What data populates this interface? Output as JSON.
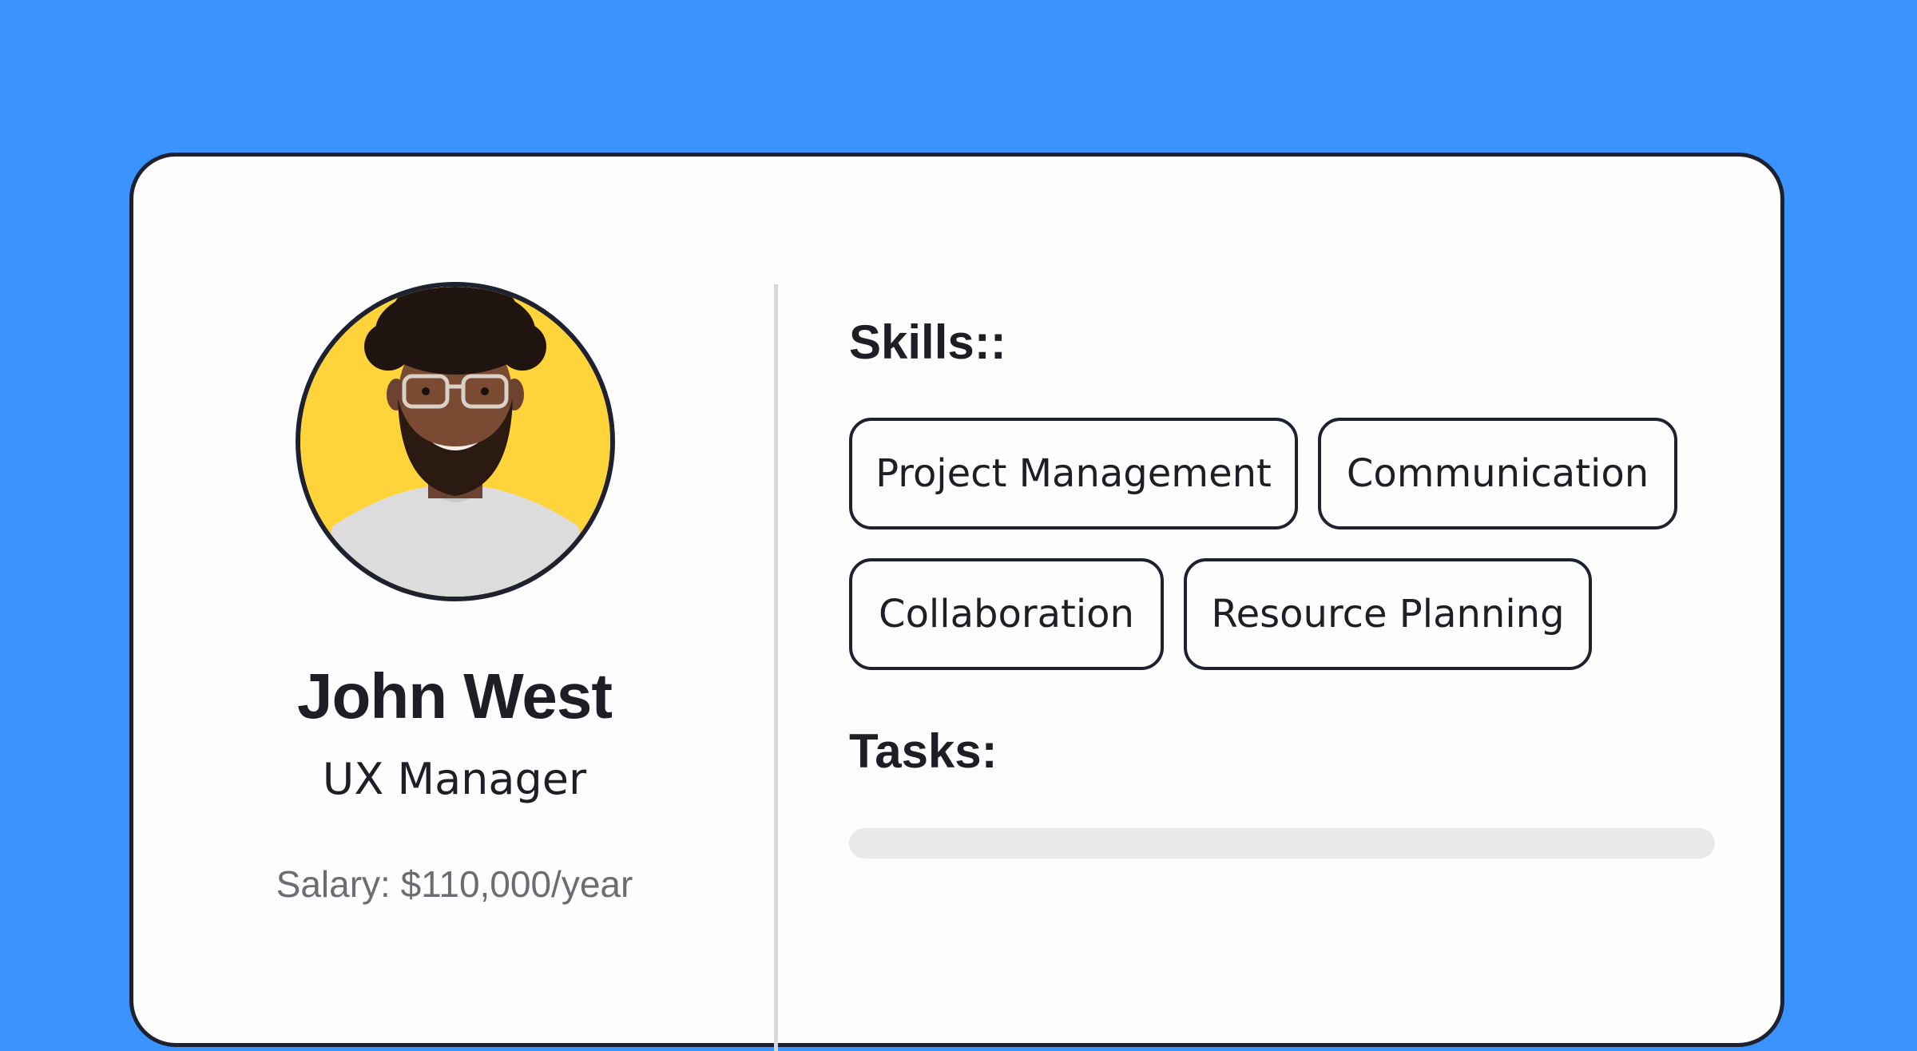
{
  "profile": {
    "name": "John West",
    "role": "UX Manager",
    "salary": "Salary: $110,000/year"
  },
  "skills": {
    "title": "Skills::",
    "items": [
      "Project Management",
      "Communication",
      "Collaboration",
      "Resource Planning"
    ]
  },
  "tasks": {
    "title": "Tasks:",
    "progress_fraction": 0
  },
  "colors": {
    "background": "#3a93ff",
    "card": "#fdfdfe",
    "border": "#1d2130",
    "avatar_bg": "#ffd43b",
    "progress_track": "#e9e8eb",
    "muted_text": "#6c6c74"
  }
}
